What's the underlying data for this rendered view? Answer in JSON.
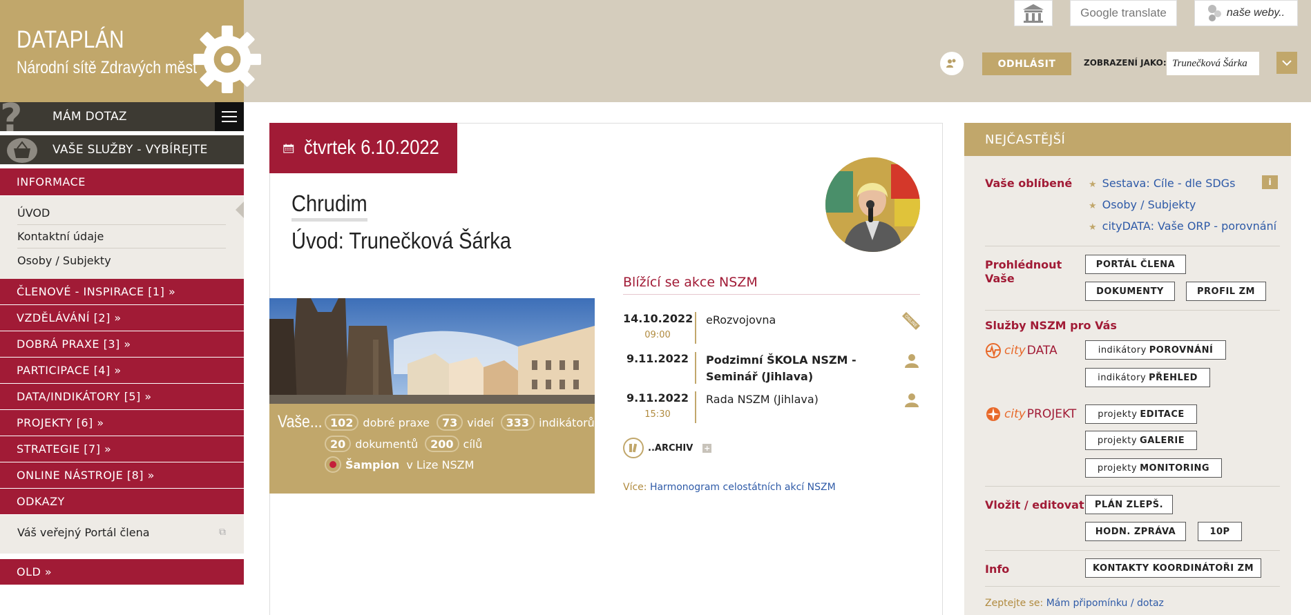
{
  "brand": {
    "title": "DATAPLÁN",
    "subtitle": "Národní sítě Zdravých měst"
  },
  "top_buttons": {
    "google_translate": "Google translate",
    "nase_weby": "naše weby.."
  },
  "header": {
    "logout": "ODHLÁSIT",
    "view_as_label": "ZOBRAZENÍ JAKO:",
    "view_as_value": "Trunečková Šárka"
  },
  "sidebar": {
    "mam_dotaz": "MÁM DOTAZ",
    "vase_sluzby": "VAŠE SLUŽBY - VYBÍREJTE",
    "informace": "INFORMACE",
    "info_items": [
      "ÚVOD",
      "Kontaktní údaje",
      "Osoby / Subjekty"
    ],
    "sections": [
      "ČLENOVÉ - INSPIRACE [1] »",
      "VZDĚLÁVÁNÍ [2] »",
      "DOBRÁ PRAXE [3] »",
      "PARTICIPACE [4] »",
      "DATA/INDIKÁTORY [5] »",
      "PROJEKTY [6] »",
      "STRATEGIE [7] »",
      "ONLINE NÁSTROJE [8] »"
    ],
    "odkazy": "ODKAZY",
    "odkazy_items": [
      "Váš veřejný Portál člena"
    ],
    "old": "OLD »"
  },
  "main": {
    "date": "čtvrtek 6.10.2022",
    "city": "Chrudim",
    "subtitle": "Úvod: Trunečková Šárka",
    "stats": {
      "prefix": "Vaše...",
      "dobre_praxe_count": "102",
      "dobre_praxe_label": "dobré praxe",
      "videi_count": "73",
      "videi_label": "videí",
      "indikatoru_count": "333",
      "indikatoru_label": "indikátorů",
      "dokumentu_count": "20",
      "dokumentu_label": "dokumentů",
      "cilu_count": "200",
      "cilu_label": "cílů",
      "sampion": "Šampion",
      "liga": "v Lize NSZM"
    },
    "events_title": "Blížící se akce NSZM",
    "events": [
      {
        "date": "14.10.2022",
        "time": "09:00",
        "title": "eRozvojovna",
        "icon": "online-badge-icon"
      },
      {
        "date": "9.11.2022",
        "time": "",
        "title": "Podzimní ŠKOLA NSZM - Seminář (Jihlava)",
        "icon": "person-icon"
      },
      {
        "date": "9.11.2022",
        "time": "15:30",
        "title": "Rada NSZM (Jihlava)",
        "icon": "person-icon"
      }
    ],
    "online_badge": "ONLINE",
    "archiv": "..ARCHIV",
    "more_prefix": "Více:",
    "more_link": "Harmonogram celostátních akcí NSZM"
  },
  "right": {
    "header": "NEJČASTĚJŠÍ",
    "favorites_label": "Vaše oblíbené",
    "favorites": [
      "Sestava: Cíle - dle SDGs",
      "Osoby / Subjekty",
      "cityDATA: Vaše ORP - porovnání"
    ],
    "info_badge": "i",
    "prohlednout_label": "Prohlédnout Vaše",
    "portal_clena": "PORTÁL ČLENA",
    "dokumenty": "DOKUMENTY",
    "profil_zm": "PROFIL ZM",
    "sluzby_label": "Služby NSZM pro Vás",
    "city_prefix": "city",
    "citydata_word": "DATA",
    "citydata_prefix": "indikátory",
    "citydata_btn1": "POROVNÁNÍ",
    "citydata_btn2": "PŘEHLED",
    "cityprojekt_word": "PROJEKT",
    "projekty_prefix": "projekty",
    "projekt_btn1": "EDITACE",
    "projekt_btn2": "GALERIE",
    "projekt_btn3": "MONITORING",
    "vlozit_label": "Vložit / editovat",
    "plan": "PLÁN ZLEPŠ.",
    "hodn": "HODN. ZPRÁVA",
    "tenp": "10P",
    "info_label": "Info",
    "kontakty": "KONTAKTY KOORDINÁTOŘI ZM",
    "ask_prefix": "Zeptejte se:",
    "ask_link": "Mám připomínku / dotaz"
  },
  "colors": {
    "gold": "#c1a76b",
    "crimson": "#a11b36",
    "beige": "#d5cdbd",
    "dark": "#3d3a33",
    "link": "#2e5aa7"
  }
}
